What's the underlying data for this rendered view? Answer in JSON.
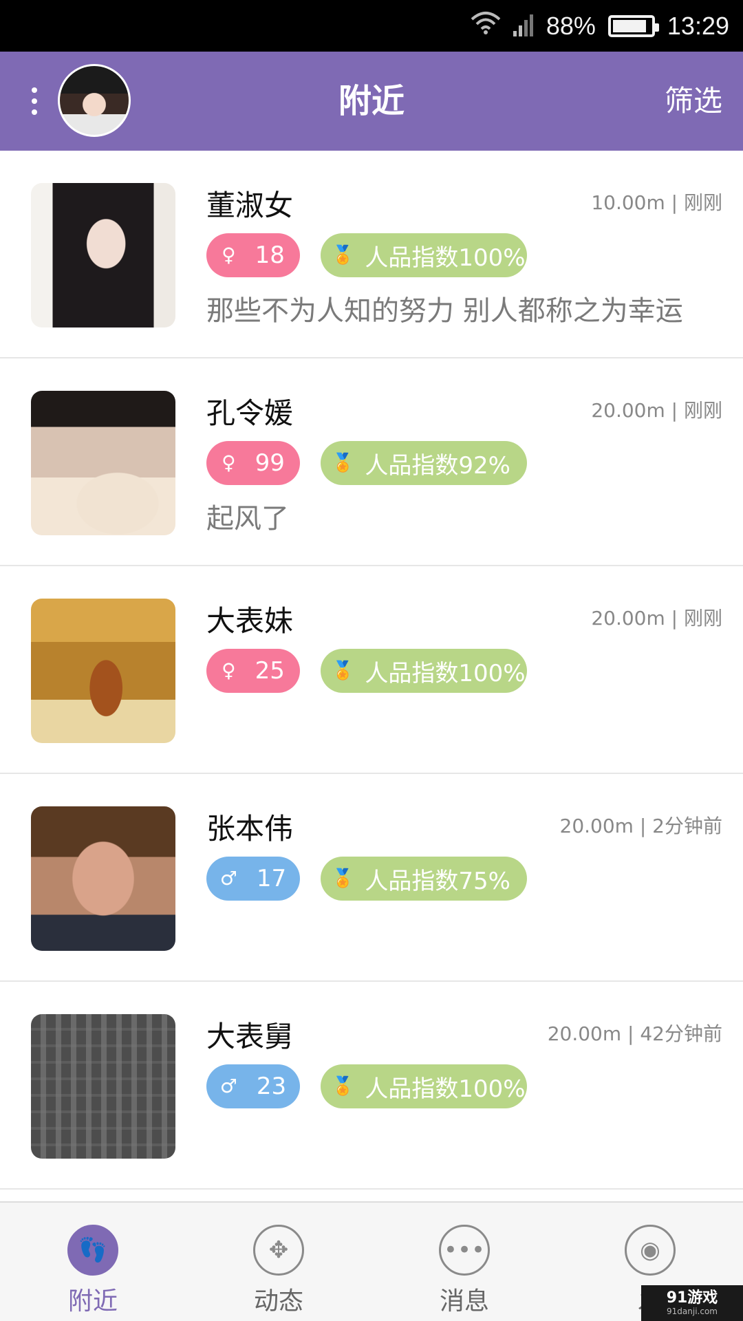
{
  "status_bar": {
    "battery": "88%",
    "time": "13:29",
    "battery_level": 0.88
  },
  "header": {
    "title": "附近",
    "filter_label": "筛选"
  },
  "users": [
    {
      "name": "董淑女",
      "meta": "10.00m | 刚刚",
      "gender": "female",
      "gender_icon": "♀",
      "age": "18",
      "character": "人品指数100%",
      "signature": "那些不为人知的努力 别人都称之为幸运"
    },
    {
      "name": "孔令媛",
      "meta": "20.00m | 刚刚",
      "gender": "female",
      "gender_icon": "♀",
      "age": "99",
      "character": "人品指数92%",
      "signature": "起风了"
    },
    {
      "name": "大表妹",
      "meta": "20.00m | 刚刚",
      "gender": "female",
      "gender_icon": "♀",
      "age": "25",
      "character": "人品指数100%",
      "signature": ""
    },
    {
      "name": "张本伟",
      "meta": "20.00m | 2分钟前",
      "gender": "male",
      "gender_icon": "♂",
      "age": "17",
      "character": "人品指数75%",
      "signature": ""
    },
    {
      "name": "大表舅",
      "meta": "20.00m | 42分钟前",
      "gender": "male",
      "gender_icon": "♂",
      "age": "23",
      "character": "人品指数100%",
      "signature": ""
    }
  ],
  "bottom_nav": {
    "tabs": [
      {
        "label": "附近",
        "icon": "footprint-icon",
        "glyph": "👣",
        "active": true
      },
      {
        "label": "动态",
        "icon": "pinwheel-icon",
        "glyph": "✥",
        "active": false
      },
      {
        "label": "消息",
        "icon": "chat-dots-icon",
        "glyph": "•••",
        "active": false
      },
      {
        "label": "发",
        "icon": "eye-icon",
        "glyph": "◉",
        "active": false
      }
    ]
  },
  "watermark": {
    "main": "91游戏",
    "sub": "91danji.com"
  },
  "colors": {
    "accent": "#7f6ab4",
    "female": "#f7799a",
    "male": "#77b4ea",
    "character": "#b8d687"
  }
}
